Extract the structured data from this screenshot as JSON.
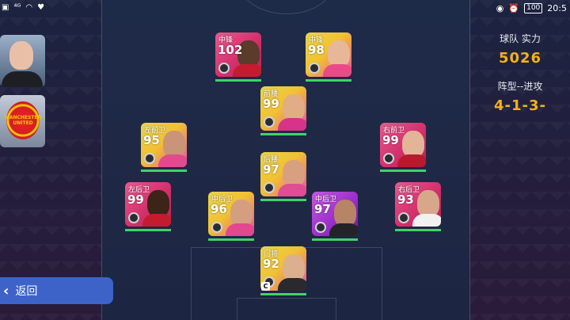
{
  "status_bar": {
    "left_icons": [
      "sim-icon",
      "signal-icon",
      "wifi-icon",
      "heart-icon"
    ],
    "battery": "100",
    "time": "20:5"
  },
  "manager": {
    "name": ""
  },
  "club": {
    "crest_text": "MANCHESTER UNITED"
  },
  "back_button": {
    "label": "返回"
  },
  "team_info": {
    "strength_label": "球队 实力",
    "strength_value": "5026",
    "formation_label": "阵型--进攻",
    "formation_value": "4-1-3-"
  },
  "players": [
    {
      "position": "中锋",
      "rating": "102",
      "style": "pink"
    },
    {
      "position": "中锋",
      "rating": "98",
      "style": "gold"
    },
    {
      "position": "前腰",
      "rating": "99",
      "style": "gold"
    },
    {
      "position": "左前卫",
      "rating": "95",
      "style": "gold"
    },
    {
      "position": "右前卫",
      "rating": "99",
      "style": "pink"
    },
    {
      "position": "后腰",
      "rating": "97",
      "style": "gold"
    },
    {
      "position": "左后卫",
      "rating": "99",
      "style": "pink"
    },
    {
      "position": "中后卫",
      "rating": "96",
      "style": "gold"
    },
    {
      "position": "中后卫",
      "rating": "97",
      "style": "purple"
    },
    {
      "position": "右后卫",
      "rating": "93",
      "style": "pink"
    },
    {
      "position": "门将",
      "rating": "92",
      "style": "gold"
    }
  ],
  "captain_label": "C"
}
